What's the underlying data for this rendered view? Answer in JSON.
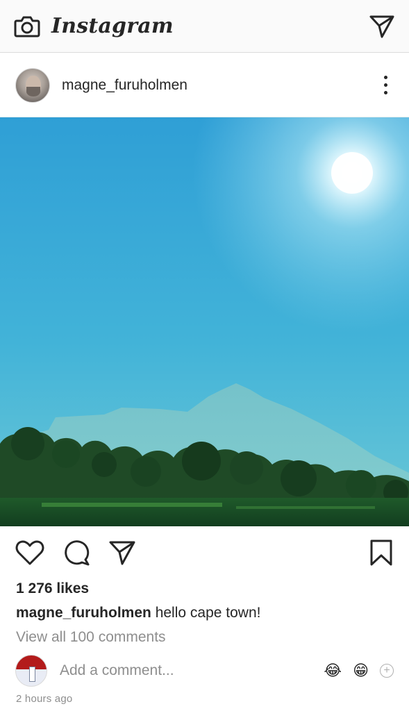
{
  "topbar": {
    "camera_icon": "camera-icon",
    "app_title": "Instagram",
    "direct_icon": "paper-plane-icon"
  },
  "post": {
    "username": "magne_furuholmen",
    "more_icon": "more-vertical-icon",
    "image_alt": "Mountain under bright sun with trees",
    "likes": "1 276 likes",
    "caption_user": "magne_furuholmen",
    "caption_text": " hello cape town!",
    "view_comments": "View all 100 comments",
    "timestamp": "2 hours ago"
  },
  "actions": {
    "like_icon": "heart-icon",
    "comment_icon": "comment-icon",
    "share_icon": "paper-plane-icon",
    "save_icon": "bookmark-icon"
  },
  "comment_box": {
    "placeholder": "Add a comment...",
    "emoji_1": "😂",
    "emoji_2": "😁",
    "add_emoji_icon": "plus-circle-icon",
    "add_emoji_label": "+"
  }
}
